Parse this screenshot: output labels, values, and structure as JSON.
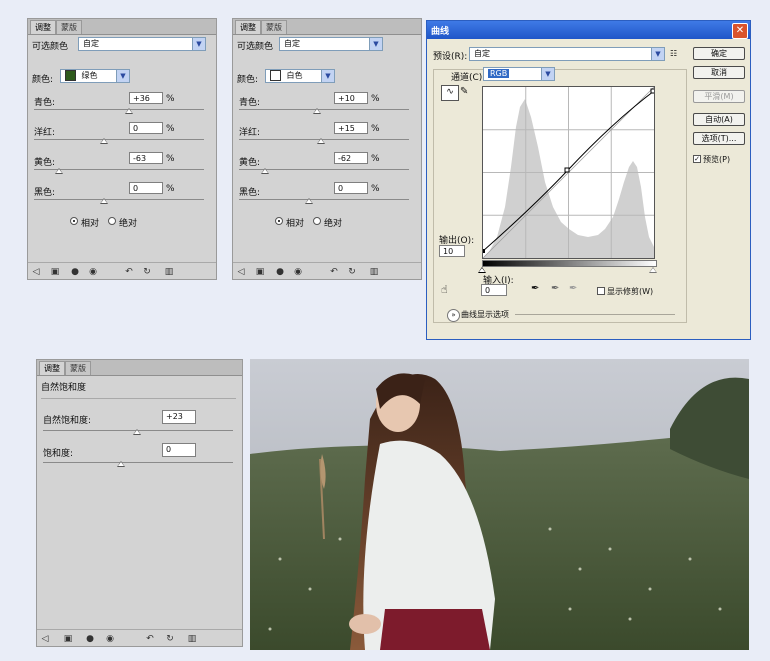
{
  "panel1": {
    "tab_active": "调整",
    "tab_inactive": "蒙版",
    "title": "可选颜色",
    "preset_value": "自定",
    "color_label": "颜色:",
    "color_value": "绿色",
    "swatch_color": "#2e5a1c",
    "rows": [
      {
        "label": "青色:",
        "value": "+36",
        "unit": "%"
      },
      {
        "label": "洋红:",
        "value": "0",
        "unit": "%"
      },
      {
        "label": "黄色:",
        "value": "-63",
        "unit": "%"
      },
      {
        "label": "黑色:",
        "value": "0",
        "unit": "%"
      }
    ],
    "radio_relative": "相对",
    "radio_absolute": "绝对"
  },
  "panel2": {
    "tab_active": "调整",
    "tab_inactive": "蒙版",
    "title": "可选颜色",
    "preset_value": "自定",
    "color_label": "颜色:",
    "color_value": "白色",
    "swatch_color": "#ffffff",
    "rows": [
      {
        "label": "青色:",
        "value": "+10",
        "unit": "%"
      },
      {
        "label": "洋红:",
        "value": "+15",
        "unit": "%"
      },
      {
        "label": "黄色:",
        "value": "-62",
        "unit": "%"
      },
      {
        "label": "黑色:",
        "value": "0",
        "unit": "%"
      }
    ],
    "radio_relative": "相对",
    "radio_absolute": "绝对"
  },
  "curves": {
    "title": "曲线",
    "preset_label": "预设(R):",
    "preset_value": "自定",
    "channel_label": "通道(C):",
    "channel_value": "RGB",
    "output_label": "输出(O):",
    "output_value": "10",
    "input_label": "输入(I):",
    "input_value": "0",
    "clipping_label": "显示修剪(W)",
    "display_options": "曲线显示选项",
    "buttons": {
      "ok": "确定",
      "cancel": "取消",
      "smooth": "平滑(M)",
      "auto": "自动(A)",
      "options": "选项(T)...",
      "preview": "预览(P)"
    },
    "title_bar_color": "#2b63d6"
  },
  "panel3": {
    "tab_active": "调整",
    "tab_inactive": "蒙版",
    "title": "自然饱和度",
    "rows": [
      {
        "label": "自然饱和度:",
        "value": "+23"
      },
      {
        "label": "饱和度:",
        "value": "0"
      }
    ]
  }
}
